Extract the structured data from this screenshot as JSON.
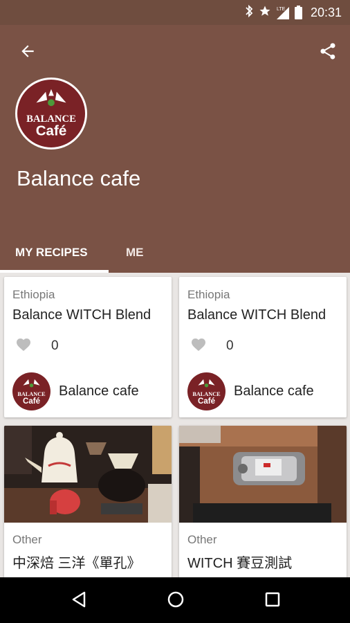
{
  "status_bar": {
    "time": "20:31",
    "lte_label": "LTE",
    "icons": [
      "bluetooth-icon",
      "star-icon",
      "signal-icon",
      "battery-icon"
    ]
  },
  "header": {
    "back_icon": "arrow-back-icon",
    "share_icon": "share-icon",
    "profile_name": "Balance cafe",
    "logo": {
      "top_text": "BALANCE",
      "bottom_text": "Café"
    }
  },
  "tabs": [
    {
      "label": "MY RECIPES",
      "selected": true
    },
    {
      "label": "ME",
      "selected": false
    }
  ],
  "recipes": [
    {
      "origin": "Ethiopia",
      "title": "Balance WITCH Blend",
      "likes": "0",
      "author": "Balance cafe"
    },
    {
      "origin": "Ethiopia",
      "title": "Balance WITCH Blend",
      "likes": "0",
      "author": "Balance cafe"
    },
    {
      "origin": "Other",
      "title": "中深焙 三洋《單孔》"
    },
    {
      "origin": "Other",
      "title": "WITCH 賽豆測試"
    }
  ],
  "colors": {
    "primary": "#7a5245",
    "status_bar": "#6f4d3f",
    "logo_bg": "#7a2226"
  },
  "nav_bar": {
    "icons": [
      "nav-back-icon",
      "nav-home-icon",
      "nav-recent-icon"
    ]
  }
}
